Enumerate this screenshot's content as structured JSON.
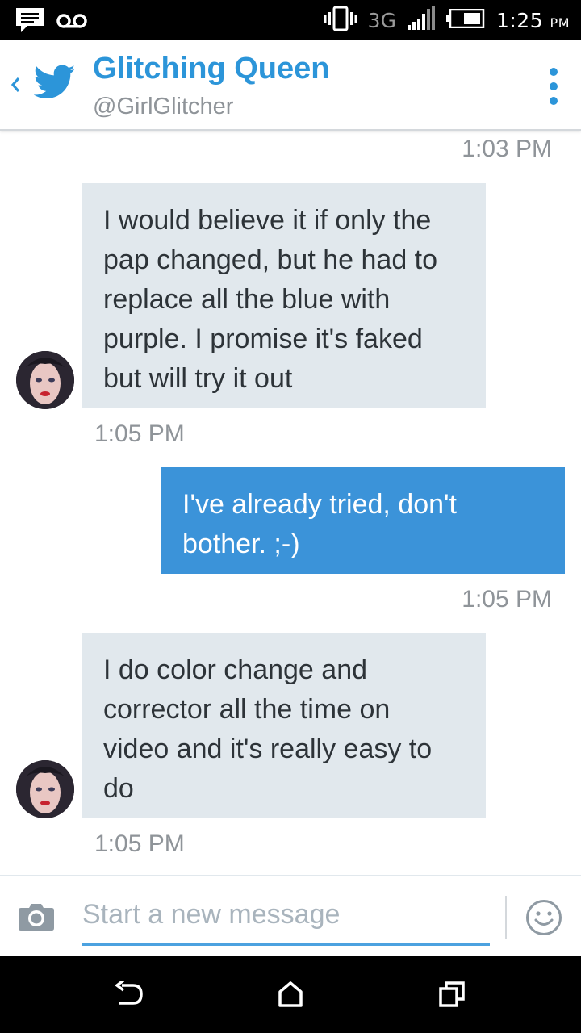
{
  "status_bar": {
    "network": "3G",
    "time": "1:25",
    "ampm": "PM",
    "icons": [
      "message-notification-icon",
      "voicemail-icon",
      "vibrate-icon",
      "signal-icon",
      "battery-icon"
    ]
  },
  "header": {
    "name": "Glitching Queen",
    "handle": "@GirlGlitcher",
    "accent_color": "#2c95d9",
    "icons": [
      "back-icon",
      "twitter-bird-icon",
      "overflow-menu-icon"
    ]
  },
  "messages": [
    {
      "time": "1:03 PM"
    },
    {
      "direction": "incoming",
      "lines": [
        "I would believe it if only the",
        "pap changed, but he had to",
        "replace all the blue with",
        "purple. I promise it's faked",
        "but will try it out"
      ],
      "time": "1:05 PM"
    },
    {
      "direction": "outgoing",
      "lines": [
        "I've already tried, don't",
        "bother. ;-)"
      ],
      "time": "1:05 PM"
    },
    {
      "direction": "incoming",
      "lines": [
        "I do color change and",
        "corrector all the time on",
        "video and it's really easy to",
        "do"
      ],
      "time": "1:05 PM"
    }
  ],
  "colors": {
    "incoming_bubble": "#e1e8ed",
    "outgoing_bubble": "#3b93d9",
    "timestamp": "#8f9499"
  },
  "composer": {
    "placeholder": "Start a new message",
    "value": "",
    "icons": [
      "camera-icon",
      "emoji-icon"
    ]
  },
  "nav": {
    "icons": [
      "back-nav-icon",
      "home-nav-icon",
      "recent-apps-icon"
    ]
  }
}
